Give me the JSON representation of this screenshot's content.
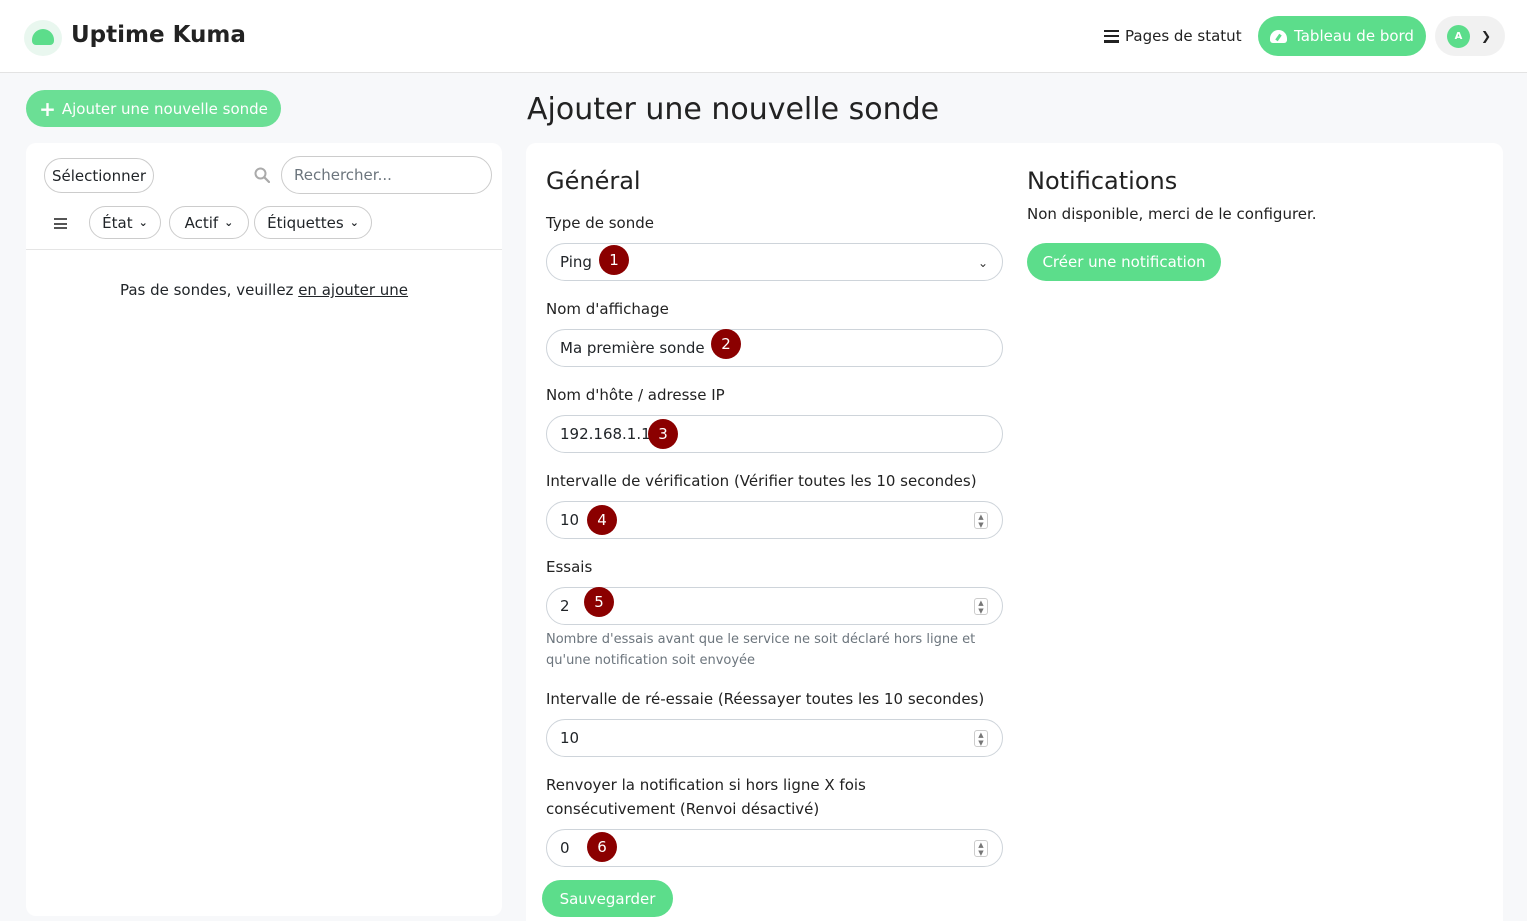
{
  "header": {
    "app_title": "Uptime Kuma",
    "status_pages_label": "Pages de statut",
    "dashboard_label": "Tableau de bord",
    "avatar_initial": "A"
  },
  "sidebar": {
    "add_label": "Ajouter une nouvelle sonde",
    "select_label": "Sélectionner",
    "search_placeholder": "Rechercher...",
    "filters": [
      "État",
      "Actif",
      "Étiquettes"
    ],
    "empty_text": "Pas de sondes, veuillez ",
    "empty_link": "en ajouter une"
  },
  "main": {
    "page_title": "Ajouter une nouvelle sonde",
    "general_title": "Général",
    "fields": [
      {
        "label": "Type de sonde",
        "value": "Ping",
        "badge": "1"
      },
      {
        "label": "Nom d'affichage",
        "value": "Ma première sonde",
        "badge": "2"
      },
      {
        "label": "Nom d'hôte / adresse IP",
        "value": "192.168.1.1",
        "badge": "3"
      },
      {
        "label": "Intervalle de vérification (Vérifier toutes les 10 secondes)",
        "value": "10",
        "badge": "4"
      },
      {
        "label": "Essais",
        "value": "2",
        "badge": "5"
      },
      {
        "label": "Intervalle de ré-essaie (Réessayer toutes les 10 secondes)",
        "value": "10"
      },
      {
        "label": "Renvoyer la notification si hors ligne X fois consécutivement (Renvoi désactivé)",
        "value": "0",
        "badge": "6"
      }
    ],
    "retries_help": "Nombre d'essais avant que le service ne soit déclaré hors ligne et qu'une notification soit envoyée",
    "notifications_title": "Notifications",
    "notifications_text": "Non disponible, merci de le configurer.",
    "create_notification_label": "Créer une notification",
    "save_label": "Sauvegarder"
  },
  "colors": {
    "accent": "#5cdd8b",
    "badge": "#8b0000"
  }
}
